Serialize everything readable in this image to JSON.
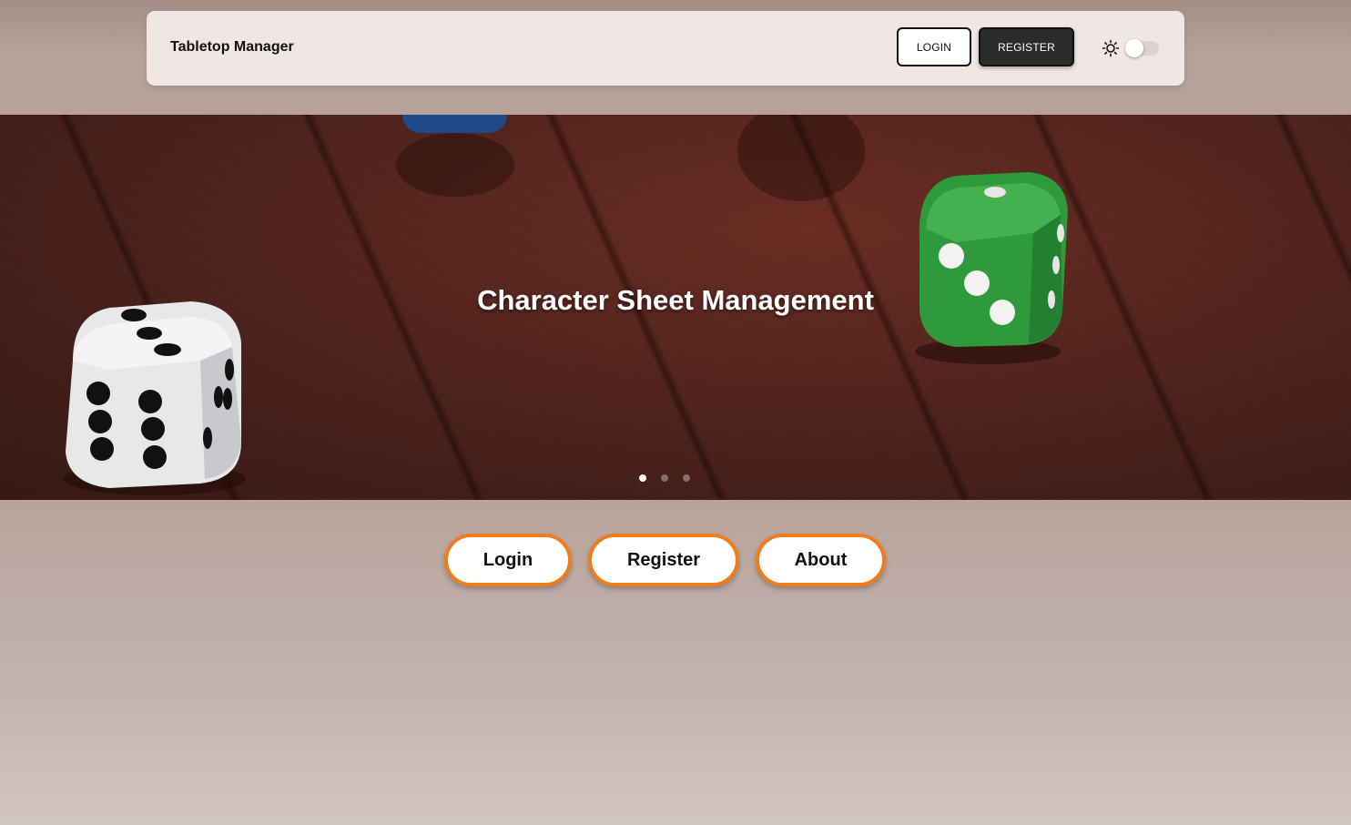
{
  "navbar": {
    "brand": "Tabletop Manager",
    "login_label": "LOGIN",
    "register_label": "REGISTER",
    "theme_icon": "sun-icon",
    "theme_toggle_on": false
  },
  "hero": {
    "title": "Character Sheet Management",
    "slide_count": 3,
    "active_slide": 1
  },
  "actions": {
    "login_label": "Login",
    "register_label": "Register",
    "about_label": "About"
  },
  "colors": {
    "accent": "#f07c1b",
    "nav_bg": "#f0e6e3",
    "dark_button": "#2b2b2b"
  }
}
